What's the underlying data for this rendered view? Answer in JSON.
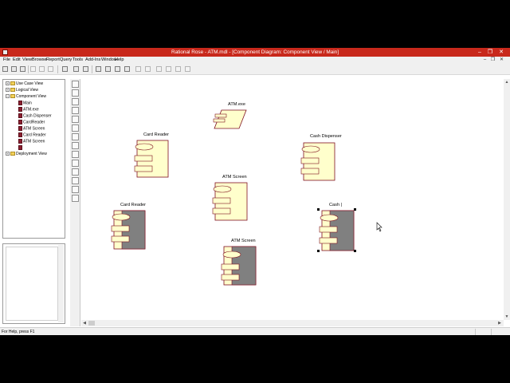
{
  "window": {
    "title": "Rational Rose - ATM.mdl - [Component Diagram: Component View / Main]",
    "min_glyph": "–",
    "max_glyph": "❐",
    "close_glyph": "✕"
  },
  "menu": {
    "items": [
      "File",
      "Edit",
      "View",
      "Browse",
      "Report",
      "Query",
      "Tools",
      "Add-Ins",
      "Window",
      "Help"
    ],
    "mdi_min": "–",
    "mdi_max": "❐",
    "mdi_close": "✕"
  },
  "browser": {
    "tree": [
      {
        "label": "Use Case View",
        "kind": "folder",
        "depth": 0,
        "expander": "+"
      },
      {
        "label": "Logical View",
        "kind": "folder",
        "depth": 0,
        "expander": "+"
      },
      {
        "label": "Component View",
        "kind": "folder",
        "depth": 0,
        "expander": "−"
      },
      {
        "label": "Main",
        "kind": "component",
        "depth": 1
      },
      {
        "label": "ATM.exe",
        "kind": "component",
        "depth": 1
      },
      {
        "label": "Cash Dispenser",
        "kind": "component",
        "depth": 1
      },
      {
        "label": "CardReader",
        "kind": "component",
        "depth": 1
      },
      {
        "label": "ATM Screen",
        "kind": "component",
        "depth": 1
      },
      {
        "label": "Card Reader",
        "kind": "component",
        "depth": 1
      },
      {
        "label": "ATM Screen",
        "kind": "component",
        "depth": 1
      },
      {
        "label": "",
        "kind": "component",
        "depth": 1
      },
      {
        "label": "Deployment View",
        "kind": "folder",
        "depth": 0,
        "expander": "+"
      }
    ]
  },
  "diagram": {
    "components": [
      {
        "label": "ATM.exe",
        "kind": "main-program"
      },
      {
        "label": "Card Reader",
        "kind": "spec"
      },
      {
        "label": "Cash Dispenser",
        "kind": "spec"
      },
      {
        "label": "ATM Screen",
        "kind": "spec"
      },
      {
        "label": "Card Reader",
        "kind": "body"
      },
      {
        "label": "ATM Screen",
        "kind": "body"
      },
      {
        "label": "Cash |",
        "kind": "body-selected"
      }
    ],
    "colors": {
      "spec_fill": "#ffffcc",
      "body_fill": "#808080",
      "outline": "#7f1020",
      "selection_handle": "#000000"
    }
  },
  "scroll": {
    "up": "▲",
    "down": "▼",
    "left": "◀",
    "right": "▶"
  },
  "status": {
    "text": "For Help, press F1"
  }
}
